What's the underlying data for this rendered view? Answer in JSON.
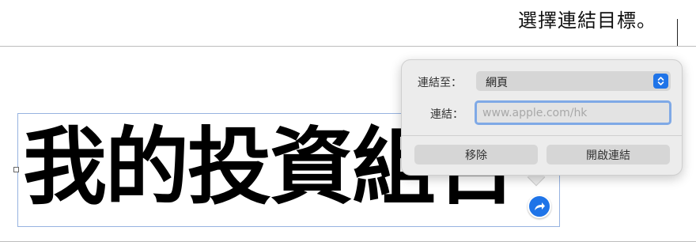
{
  "callout": {
    "text": "選擇連結目標。"
  },
  "textbox": {
    "heading": "我的投資組合"
  },
  "link_popover": {
    "link_to_label": "連結至：",
    "link_to_value": "網頁",
    "link_label": "連結：",
    "link_placeholder": "www.apple.com/hk",
    "remove_button": "移除",
    "open_link_button": "開啟連結"
  },
  "icons": {
    "select_arrows": "chevron-up-down-icon",
    "link_badge": "curved-arrow-icon"
  },
  "colors": {
    "accent": "#1f74e8",
    "popover_bg": "#ececec",
    "focus_ring": "#7fa9e6"
  }
}
